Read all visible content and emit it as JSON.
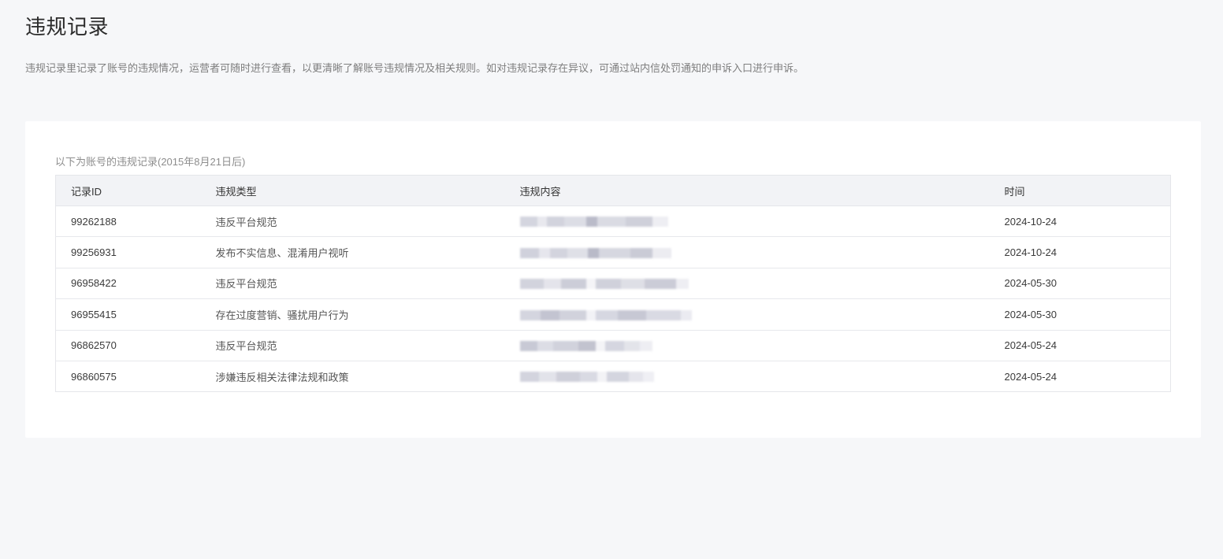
{
  "page": {
    "title": "违规记录",
    "description": "违规记录里记录了账号的违规情况，运营者可随时进行查看，以更清晰了解账号违规情况及相关规则。如对违规记录存在异议，可通过站内信处罚通知的申诉入口进行申诉。"
  },
  "table": {
    "caption": "以下为账号的违规记录(2015年8月21日后)",
    "headers": {
      "id": "记录ID",
      "type": "违规类型",
      "content": "违规内容",
      "time": "时间"
    },
    "rows": [
      {
        "id": "99262188",
        "type": "违反平台规范",
        "time": "2024-10-24"
      },
      {
        "id": "99256931",
        "type": "发布不实信息、混淆用户视听",
        "time": "2024-10-24"
      },
      {
        "id": "96958422",
        "type": "违反平台规范",
        "time": "2024-05-30"
      },
      {
        "id": "96955415",
        "type": "存在过度营销、骚扰用户行为",
        "time": "2024-05-30"
      },
      {
        "id": "96862570",
        "type": "违反平台规范",
        "time": "2024-05-24"
      },
      {
        "id": "96860575",
        "type": "涉嫌违反相关法律法规和政策",
        "time": "2024-05-24"
      }
    ]
  },
  "colors": {
    "background": "#f6f7f9",
    "card": "#ffffff",
    "header_row": "#f2f3f6",
    "redaction": "#c9cad6"
  }
}
